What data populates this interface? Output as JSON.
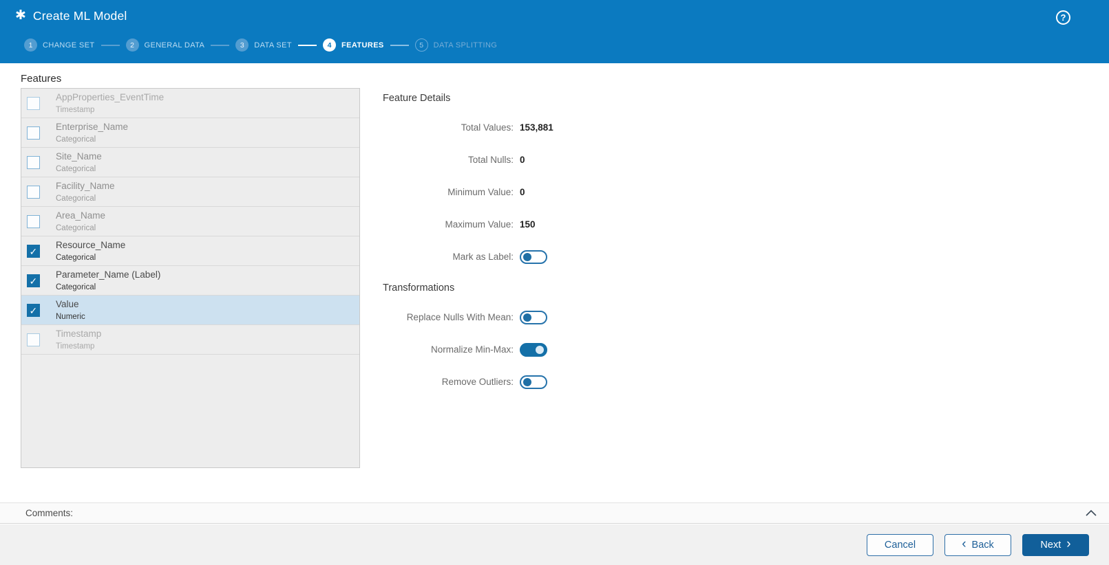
{
  "header": {
    "title": "Create ML Model"
  },
  "icons": {
    "app_logo": "✱",
    "help": "?",
    "back_chevron": "‹",
    "next_chevron": "›",
    "checkbox_check": "✓",
    "collapse": "chevron-up"
  },
  "stepper": {
    "steps": [
      {
        "number": "1",
        "label": "CHANGE SET",
        "state": "done"
      },
      {
        "number": "2",
        "label": "GENERAL DATA",
        "state": "done"
      },
      {
        "number": "3",
        "label": "DATA SET",
        "state": "done"
      },
      {
        "number": "4",
        "label": "FEATURES",
        "state": "active"
      },
      {
        "number": "5",
        "label": "DATA SPLITTING",
        "state": "upcoming"
      }
    ]
  },
  "features": {
    "title": "Features",
    "items": [
      {
        "name": "AppProperties_EventTime",
        "type": "Timestamp",
        "checked": false,
        "disabled": true,
        "selected": false
      },
      {
        "name": "Enterprise_Name",
        "type": "Categorical",
        "checked": false,
        "disabled": false,
        "selected": false
      },
      {
        "name": "Site_Name",
        "type": "Categorical",
        "checked": false,
        "disabled": false,
        "selected": false
      },
      {
        "name": "Facility_Name",
        "type": "Categorical",
        "checked": false,
        "disabled": false,
        "selected": false
      },
      {
        "name": "Area_Name",
        "type": "Categorical",
        "checked": false,
        "disabled": false,
        "selected": false
      },
      {
        "name": "Resource_Name",
        "type": "Categorical",
        "checked": true,
        "disabled": false,
        "selected": false
      },
      {
        "name": "Parameter_Name (Label)",
        "type": "Categorical",
        "checked": true,
        "disabled": false,
        "selected": false
      },
      {
        "name": "Value",
        "type": "Numeric",
        "checked": true,
        "disabled": false,
        "selected": true
      },
      {
        "name": "Timestamp",
        "type": "Timestamp",
        "checked": false,
        "disabled": true,
        "selected": false
      }
    ]
  },
  "details": {
    "title": "Feature Details",
    "stats": [
      {
        "label": "Total Values:",
        "value": "153,881"
      },
      {
        "label": "Total Nulls:",
        "value": "0"
      },
      {
        "label": "Minimum Value:",
        "value": "0"
      },
      {
        "label": "Maximum Value:",
        "value": "150"
      }
    ],
    "mark_as_label": {
      "label": "Mark as Label:",
      "on": false
    }
  },
  "transformations": {
    "title": "Transformations",
    "toggles": [
      {
        "label": "Replace Nulls With Mean:",
        "on": false
      },
      {
        "label": "Normalize Min-Max:",
        "on": true
      },
      {
        "label": "Remove Outliers:",
        "on": false
      }
    ]
  },
  "comments": {
    "label": "Comments:"
  },
  "footer": {
    "cancel_label": "Cancel",
    "back_label": "Back",
    "next_label": "Next"
  },
  "colors": {
    "header_blue": "#0b7ac0",
    "accent_blue": "#1470a8",
    "selected_row": "#cde1f0",
    "primary_button": "#115f9a"
  }
}
